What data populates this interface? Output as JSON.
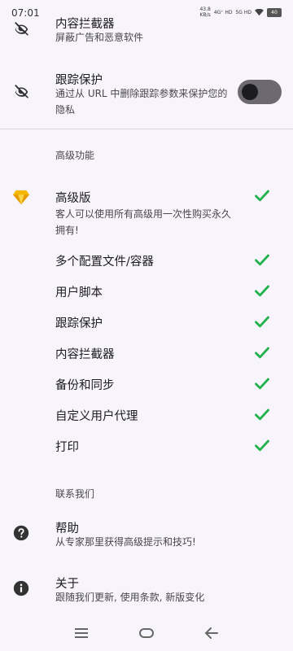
{
  "status_bar": {
    "time": "07:01",
    "speed_value": "43.8",
    "speed_unit": "KB/s",
    "signal_1": "4G⁺ HD",
    "signal_2": "5G HD",
    "battery": "40"
  },
  "top_items": [
    {
      "icon": "eye-off-icon",
      "title": "内容拦截器",
      "subtitle": "屏蔽广告和恶意软件"
    },
    {
      "icon": "eye-off-icon",
      "title": "跟踪保护",
      "subtitle": "通过从 URL 中删除跟踪参数来保护您的隐私",
      "toggle": "off"
    }
  ],
  "premium_section": {
    "header": "高级功能",
    "premium": {
      "icon": "diamond-icon",
      "title": "高级版",
      "subtitle": "客人可以使用所有高级用一次性购买永久拥有!"
    },
    "features": [
      "多个配置文件/容器",
      "用户脚本",
      "跟踪保护",
      "内容拦截器",
      "备份和同步",
      "自定义用户代理",
      "打印"
    ]
  },
  "contact_section": {
    "header": "联系我们",
    "items": [
      {
        "icon": "help-circle-icon",
        "title": "帮助",
        "subtitle": "从专家那里获得高级提示和技巧!"
      },
      {
        "icon": "info-icon",
        "title": "关于",
        "subtitle": "跟随我们更新, 使用条款, 新版变化"
      }
    ]
  },
  "colors": {
    "check": "#22b14c",
    "diamond": "#f5b800",
    "background": "#f7f5fb"
  },
  "nav": {
    "icons": [
      "menu-icon",
      "home-icon",
      "back-icon"
    ]
  }
}
